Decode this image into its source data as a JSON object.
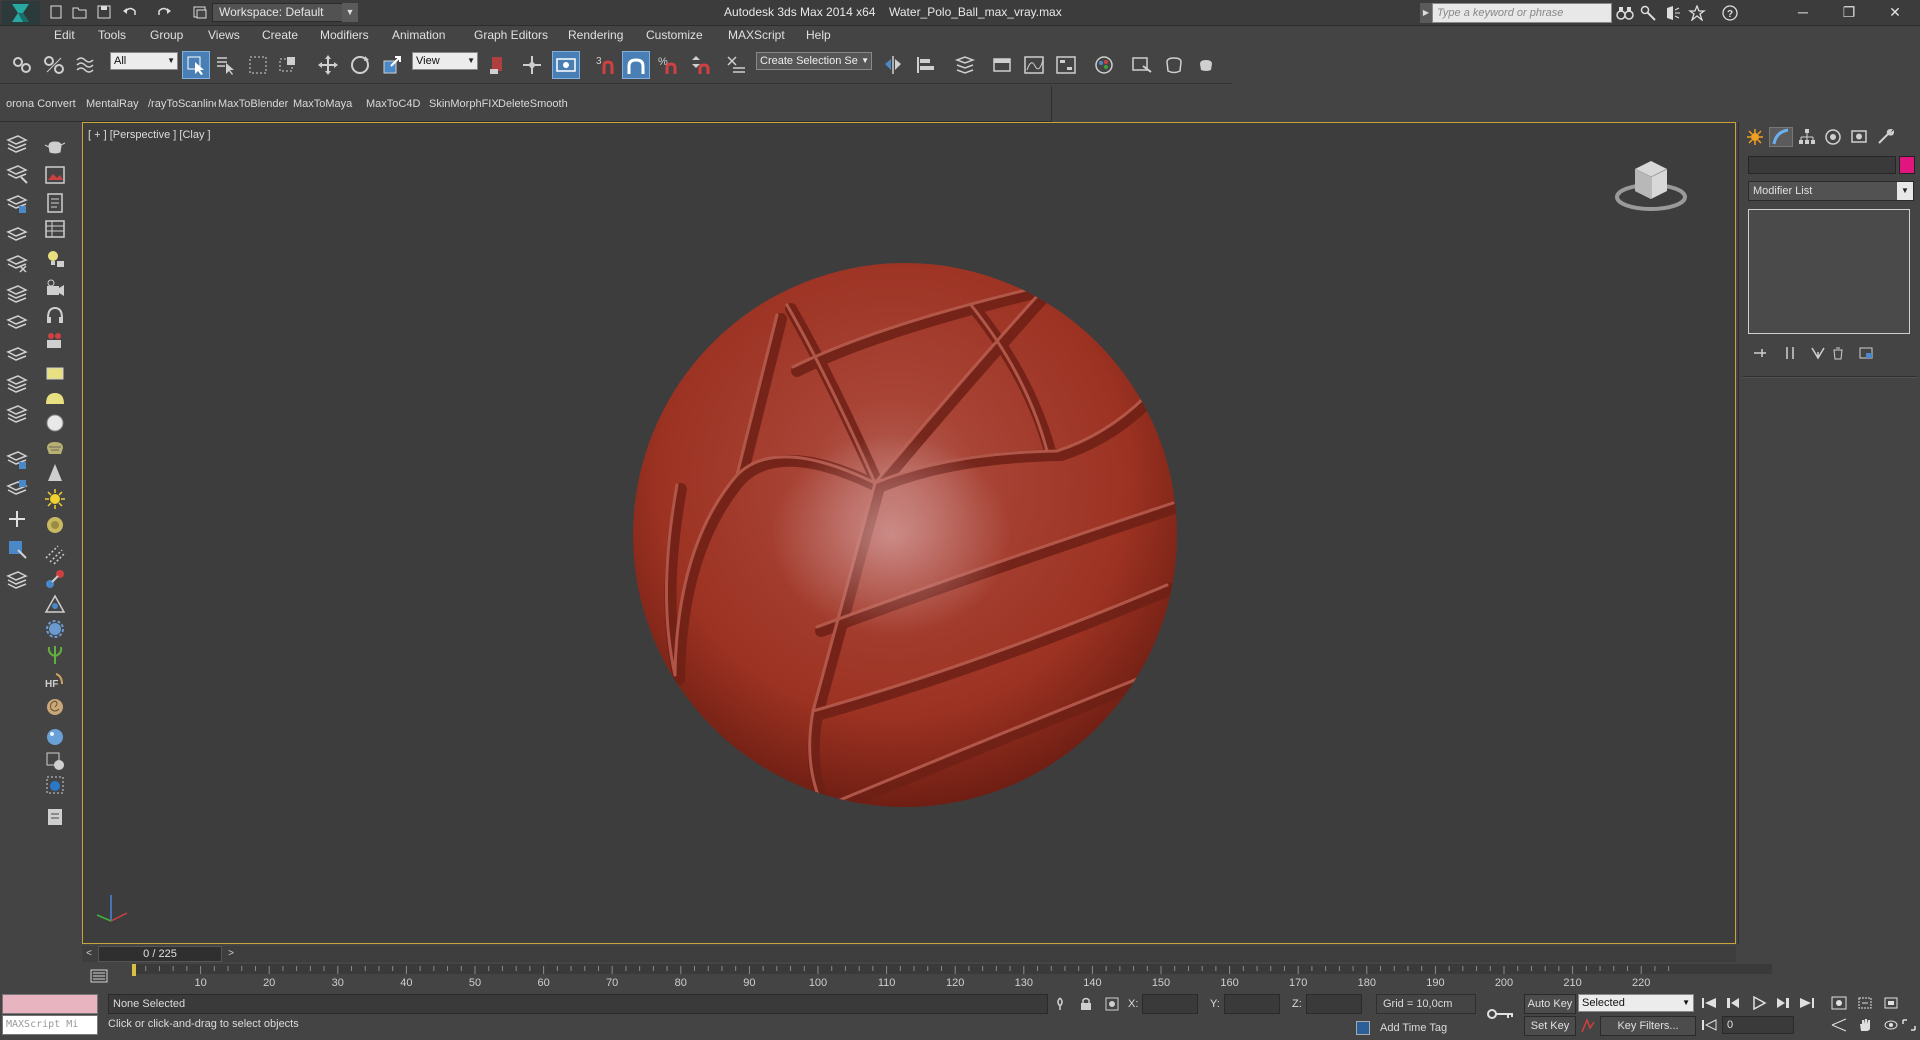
{
  "titlebar": {
    "workspace": "Workspace: Default",
    "app_title": "Autodesk 3ds Max  2014 x64",
    "file_title": "Water_Polo_Ball_max_vray.max",
    "search_placeholder": "Type a keyword or phrase",
    "minimize": "─",
    "restore": "❐",
    "close": "✕"
  },
  "menu": [
    "Edit",
    "Tools",
    "Group",
    "Views",
    "Create",
    "Modifiers",
    "Animation",
    "Graph Editors",
    "Rendering",
    "Customize",
    "MAXScript",
    "Help"
  ],
  "toolbar": {
    "selection_filter": "All",
    "reference_coord": "View",
    "named_selection_placeholder": "Create Selection Se"
  },
  "plugins": [
    "orona Convert",
    "MentalRay",
    "/rayToScanline",
    "MaxToBlender",
    "MaxToMaya",
    "MaxToC4D",
    "SkinMorphFIX",
    "DeleteSmooth"
  ],
  "viewport": {
    "label": "[ + ] [Perspective ] [Clay ]",
    "ball_color": "#a33a2c"
  },
  "command_panel": {
    "modifier_list": "Modifier List",
    "object_color": "#e0157d"
  },
  "timeslider": {
    "frame_display": "0 / 225",
    "prev": "<",
    "next": ">"
  },
  "trackbar": {
    "ticks": [
      "10",
      "20",
      "30",
      "40",
      "50",
      "60",
      "70",
      "80",
      "90",
      "100",
      "110",
      "120",
      "130",
      "140",
      "150",
      "160",
      "170",
      "180",
      "190",
      "200",
      "210",
      "220"
    ]
  },
  "status": {
    "maxscript_prompt": "MAXScript Mi",
    "selection": "None Selected",
    "prompt": "Click or click-and-drag to select objects",
    "x_label": "X:",
    "y_label": "Y:",
    "z_label": "Z:",
    "grid": "Grid = 10,0cm",
    "add_time_tag": "Add Time Tag",
    "auto_key": "Auto Key",
    "set_key": "Set Key",
    "key_mode": "Selected",
    "key_filters": "Key Filters...",
    "current_frame": "0"
  }
}
